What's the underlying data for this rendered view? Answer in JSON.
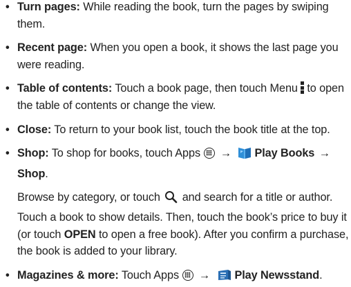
{
  "items": [
    {
      "term": "Turn pages:",
      "text": " While reading the book, turn the pages by swiping them."
    },
    {
      "term": "Recent page:",
      "text": " When you open a book, it shows the last page you were reading."
    },
    {
      "term": "Table of contents:",
      "text_before": " Touch a book page, then touch Menu",
      "text_after": "to open the table of contents or change the view."
    },
    {
      "term": "Close:",
      "text": " To return to your book list, touch the book title at the top."
    },
    {
      "term": "Shop:",
      "text_before": " To shop for books, touch Apps",
      "app_name": "Play Books",
      "last": "Shop",
      "end": "."
    }
  ],
  "shop_paragraph": {
    "before_icon": "Browse by category, or touch",
    "after_icon": " and search for a title or author. Touch a book to show details. Then, touch the book’s price to buy it (or touch ",
    "open_label": "OPEN",
    "after_open": " to open a free book). After you confirm a purchase, the book is added to your library."
  },
  "last_item": {
    "term": "Magazines & more:",
    "text": " Touch Apps",
    "app_name": "Play Newsstand",
    "end": "."
  },
  "symbols": {
    "bullet": "•",
    "arrow": "→"
  },
  "icons": [
    "menu-icon",
    "apps-icon",
    "play-books-icon",
    "search-icon",
    "play-newsstand-icon"
  ],
  "colors": {
    "text": "#222222",
    "books_blue": "#2f8fd8",
    "newsstand_blue": "#2a6fb5"
  }
}
